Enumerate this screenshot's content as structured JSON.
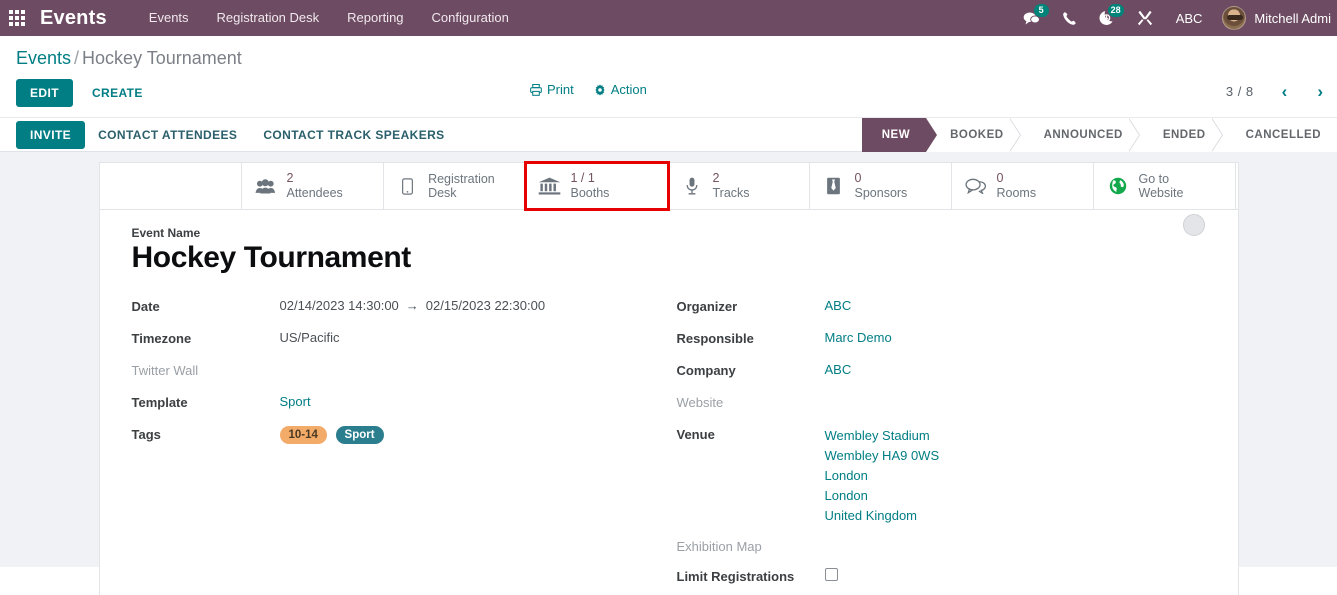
{
  "topbar": {
    "apps_icon": "apps-grid-icon",
    "brand": "Events",
    "menu": [
      {
        "label": "Events"
      },
      {
        "label": "Registration Desk"
      },
      {
        "label": "Reporting"
      },
      {
        "label": "Configuration"
      }
    ],
    "tray": {
      "messages_icon": "messages-icon",
      "messages_count": "5",
      "phone_icon": "phone-icon",
      "activity_icon": "activity-clock-icon",
      "activity_count": "28",
      "tools_icon": "tools-icon",
      "company": "ABC",
      "user_name": "Mitchell Admi"
    },
    "accent_color": "#6d4b62",
    "badge_color": "#00847a"
  },
  "control_panel": {
    "breadcrumb_root": "Events",
    "breadcrumb_sep": "/",
    "breadcrumb_current": "Hockey Tournament",
    "edit_label": "EDIT",
    "create_label": "CREATE",
    "print_label": "Print",
    "print_icon": "printer-icon",
    "action_label": "Action",
    "action_icon": "gear-icon",
    "pager_value": "3 / 8",
    "pager_prev_icon": "chevron-left-icon",
    "pager_next_icon": "chevron-right-icon",
    "accent_color": "#017e84"
  },
  "action_bar": {
    "invite_label": "INVITE",
    "contact_attendees_label": "CONTACT ATTENDEES",
    "contact_track_speakers_label": "CONTACT TRACK SPEAKERS"
  },
  "statusbar": {
    "stages": [
      {
        "label": "NEW",
        "active": true
      },
      {
        "label": "BOOKED",
        "active": false
      },
      {
        "label": "ANNOUNCED",
        "active": false
      },
      {
        "label": "ENDED",
        "active": false
      },
      {
        "label": "CANCELLED",
        "active": false
      }
    ],
    "active_color": "#6d4b62"
  },
  "stat_buttons": [
    {
      "value": "2",
      "label": "Attendees",
      "icon": "users-icon",
      "highlighted": false
    },
    {
      "value": "",
      "label": "Registration Desk",
      "icon": "mobile-icon",
      "highlighted": false
    },
    {
      "value": "1 / 1",
      "label": "Booths",
      "icon": "bank-icon",
      "highlighted": true
    },
    {
      "value": "2",
      "label": "Tracks",
      "icon": "microphone-icon",
      "highlighted": false
    },
    {
      "value": "0",
      "label": "Sponsors",
      "icon": "tie-icon",
      "highlighted": false
    },
    {
      "value": "0",
      "label": "Rooms",
      "icon": "chat-bubbles-icon",
      "highlighted": false
    },
    {
      "value": "",
      "label": "Go to Website",
      "icon": "globe-icon",
      "highlighted": false
    }
  ],
  "highlight_color": "#e60000",
  "form": {
    "event_name_label": "Event Name",
    "event_name_value": "Hockey Tournament",
    "image_placeholder": "event-image-placeholder",
    "left": {
      "date_label": "Date",
      "date_start": "02/14/2023 14:30:00",
      "date_arrow": "→",
      "date_end": "02/15/2023 22:30:00",
      "timezone_label": "Timezone",
      "timezone_value": "US/Pacific",
      "twitter_wall_label": "Twitter Wall",
      "twitter_wall_value": "",
      "template_label": "Template",
      "template_value": "Sport",
      "tags_label": "Tags",
      "tags": [
        {
          "label": "10-14",
          "color": "#f3ab6a"
        },
        {
          "label": "Sport",
          "color": "#2b7e8d"
        }
      ]
    },
    "right": {
      "organizer_label": "Organizer",
      "organizer_value": "ABC",
      "responsible_label": "Responsible",
      "responsible_value": "Marc Demo",
      "company_label": "Company",
      "company_value": "ABC",
      "website_label": "Website",
      "website_value": "",
      "venue_label": "Venue",
      "venue_lines": [
        "Wembley Stadium",
        "Wembley HA9 0WS",
        "London",
        "London",
        "United Kingdom"
      ],
      "exhibition_map_label": "Exhibition Map",
      "exhibition_map_value": "",
      "limit_registrations_label": "Limit Registrations",
      "limit_registrations_checked": false
    }
  }
}
